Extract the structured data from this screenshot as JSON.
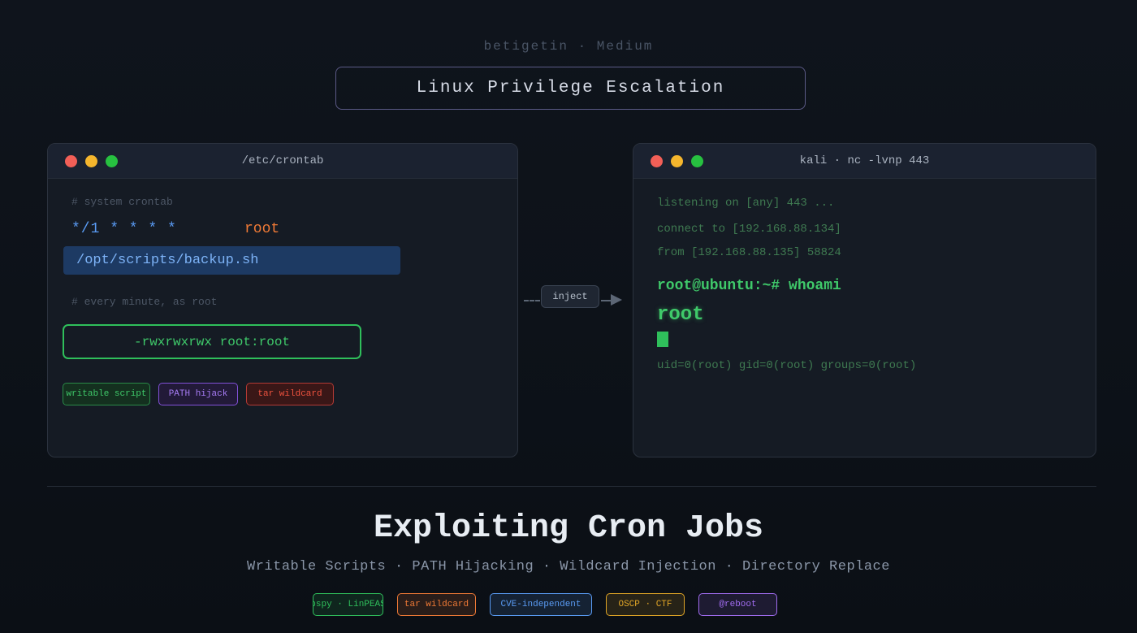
{
  "byline": "betigetin · Medium",
  "title": "Linux Privilege Escalation",
  "left_terminal": {
    "title": "/etc/crontab",
    "comment1": "# system crontab",
    "schedule": "*/1 * * * *",
    "user": "root",
    "script_path": "/opt/scripts/backup.sh",
    "comment2": "# every minute, as root",
    "permissions": "-rwxrwxrwx root:root",
    "tags": [
      "writable script",
      "PATH hijack",
      "tar wildcard"
    ]
  },
  "flow_label": "inject",
  "right_terminal": {
    "title": "kali · nc -lvnp 443",
    "line1": "listening on [any] 443 ...",
    "line2": "connect to [192.168.88.134]",
    "line3": "from [192.168.88.135] 58824",
    "prompt": "root@ubuntu:~# whoami",
    "result": "root",
    "id_line": "uid=0(root) gid=0(root) groups=0(root)"
  },
  "headline": "Exploiting Cron Jobs",
  "subheadline": "Writable Scripts · PATH Hijacking · Wildcard Injection · Directory Replace",
  "bottom_tags": [
    {
      "label": "pspy · LinPEAS",
      "color": "#2fbf5b"
    },
    {
      "label": "tar wildcard",
      "color": "#f07a36"
    },
    {
      "label": "CVE-independent",
      "color": "#5a9cf5"
    },
    {
      "label": "OSCP · CTF",
      "color": "#e0a526"
    },
    {
      "label": "@reboot",
      "color": "#a16cf0"
    }
  ],
  "colors": {
    "green": "#2fbf5b",
    "blue": "#5a9cf5",
    "orange": "#f07a36",
    "purple": "#8250d8",
    "red": "#f0533f"
  }
}
